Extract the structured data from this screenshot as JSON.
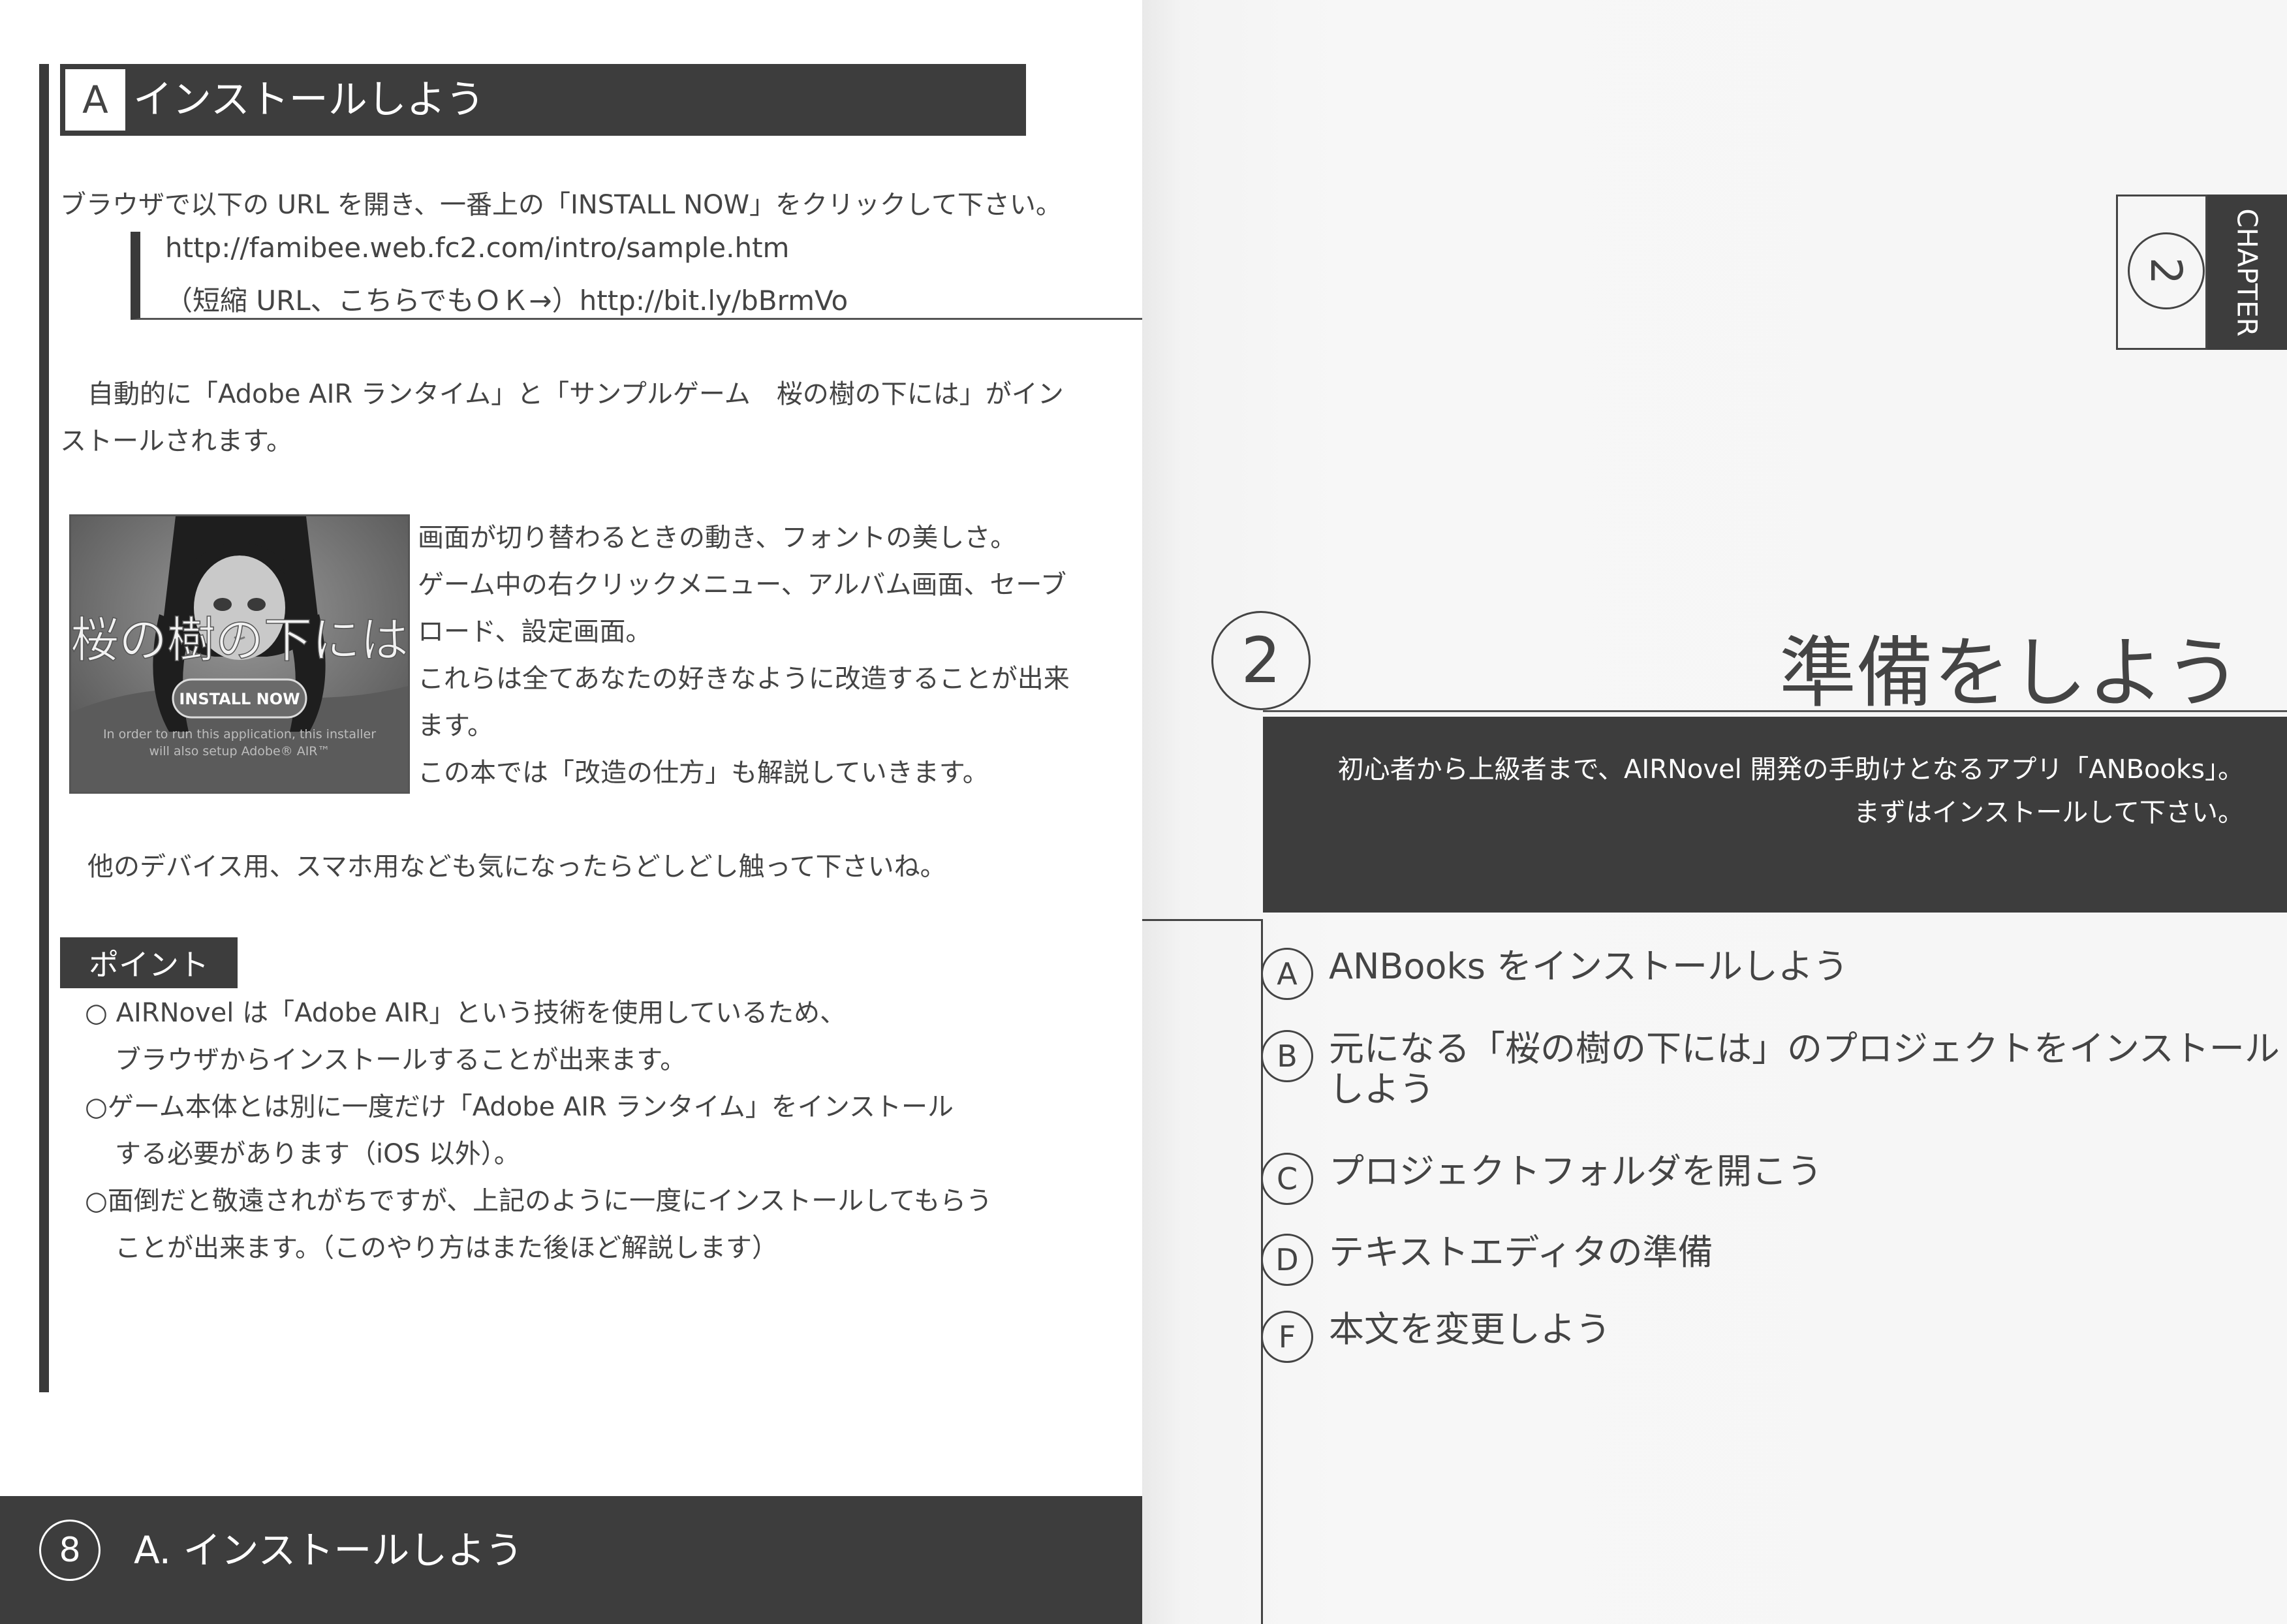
{
  "left_page": {
    "section": {
      "letter": "A",
      "title": "インストールしよう"
    },
    "instruction": "ブラウザで以下の URL を開き、一番上の「INSTALL NOW」をクリックして下さい。",
    "urls": [
      "http://famibee.web.fc2.com/intro/sample.htm",
      "（短縮 URL、こちらでもＯＫ→）http://bit.ly/bBrmVo"
    ],
    "auto_install": [
      "自動的に「Adobe AIR ランタイム」と「サンプルゲーム　桜の樹の下には」がイン",
      "ストールされます。"
    ],
    "thumbnail": {
      "game_title": "桜の樹の下には",
      "button_label": "INSTALL NOW",
      "notice_lines": [
        "In order to run this application, this installer",
        "will also setup Adobe® AIR™"
      ]
    },
    "feature_lines": [
      "画面が切り替わるときの動き、フォントの美しさ。",
      "ゲーム中の右クリックメニュー、アルバム画面、セーブ",
      "ロード、設定画面。",
      "これらは全てあなたの好きなように改造することが出来",
      "ます。",
      "この本では「改造の仕方」も解説していきます。"
    ],
    "other_devices": "他のデバイス用、スマホ用なども気になったらどしどし触って下さいね。",
    "point": {
      "label": "ポイント",
      "lines": [
        "○ AIRNovel は「Adobe AIR」という技術を使用しているため、",
        "ブラウザからインストールすることが出来ます。",
        "○ゲーム本体とは別に一度だけ「Adobe AIR ランタイム」をインストール",
        "する必要があります（iOS 以外）。",
        "○面倒だと敬遠されがちですが、上記のように一度にインストールしてもらう",
        "ことが出来ます。（このやり方はまた後ほど解説します）"
      ]
    },
    "footer": {
      "page_number": "8",
      "title": "A. インストールしよう"
    }
  },
  "right_page": {
    "chapter_tab": {
      "word": "CHAPTER",
      "number": "2"
    },
    "chapter_number": "2",
    "chapter_title": "準備をしよう",
    "intro_lines": [
      "初心者から上級者まで、AIRNovel 開発の手助けとなるアプリ「ANBooks」。",
      "まずはインストールして下さい。"
    ],
    "toc": [
      {
        "letter": "A",
        "lines": [
          "ANBooks をインストールしよう"
        ]
      },
      {
        "letter": "B",
        "lines": [
          "元になる「桜の樹の下には」のプロジェクトをインストール",
          "しよう"
        ]
      },
      {
        "letter": "C",
        "lines": [
          "プロジェクトフォルダを開こう"
        ]
      },
      {
        "letter": "D",
        "lines": [
          "テキストエディタの準備"
        ]
      },
      {
        "letter": "F",
        "lines": [
          "本文を変更しよう"
        ]
      }
    ]
  }
}
